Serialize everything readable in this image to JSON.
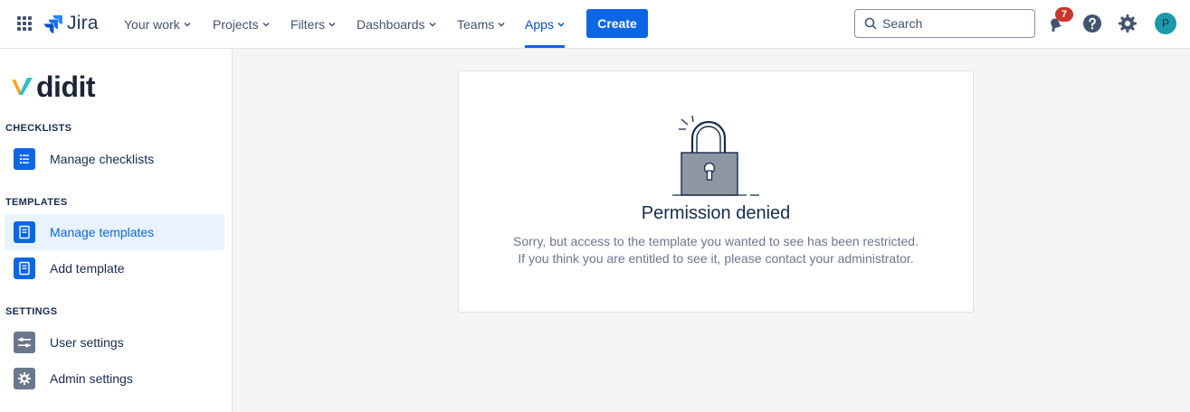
{
  "topnav": {
    "logo_text": "Jira",
    "items": [
      {
        "label": "Your work"
      },
      {
        "label": "Projects"
      },
      {
        "label": "Filters"
      },
      {
        "label": "Dashboards"
      },
      {
        "label": "Teams"
      },
      {
        "label": "Apps",
        "active": true
      }
    ],
    "create_label": "Create",
    "search_placeholder": "Search",
    "notification_count": "7",
    "avatar_initial": "P"
  },
  "sidebar": {
    "brand": "didit",
    "sections": [
      {
        "title": "CHECKLISTS",
        "items": [
          {
            "label": "Manage checklists",
            "icon": "checklist-icon"
          }
        ]
      },
      {
        "title": "TEMPLATES",
        "items": [
          {
            "label": "Manage templates",
            "icon": "template-icon",
            "selected": true
          },
          {
            "label": "Add template",
            "icon": "template-icon"
          }
        ]
      },
      {
        "title": "SETTINGS",
        "items": [
          {
            "label": "User settings",
            "icon": "sliders-icon"
          },
          {
            "label": "Admin settings",
            "icon": "gear-icon"
          }
        ]
      }
    ]
  },
  "main": {
    "title": "Permission denied",
    "line1": "Sorry, but access to the template you wanted to see has been restricted.",
    "line2": "If you think you are entitled to see it, please contact your administrator."
  },
  "colors": {
    "accent": "#0c66e4",
    "badge": "#c9372c",
    "avatar": "#1d9aaa",
    "main_bg": "#f4f5f7"
  }
}
